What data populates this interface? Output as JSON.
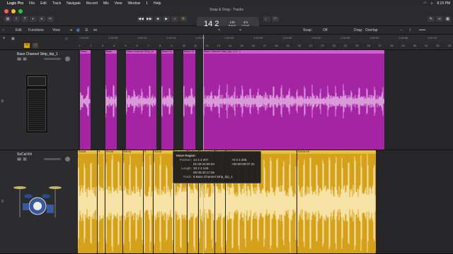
{
  "menubar": {
    "app": "Logic Pro",
    "items": [
      "File",
      "Edit",
      "Track",
      "Navigate",
      "Record",
      "Mix",
      "View",
      "Window",
      "1",
      "Help"
    ],
    "time": "8:15 PM"
  },
  "window": {
    "title": "Snap & Drag - Tracks"
  },
  "lcd": {
    "position": "14 2",
    "tempo": "145",
    "tempo_mode": "Keep",
    "signature": "4/4",
    "key": "Cmaj"
  },
  "toolbar": {
    "edit": "Edit",
    "functions": "Functions",
    "view": "View",
    "snap_label": "Snap:",
    "snap_value": "Off",
    "drag_label": "Drag:",
    "drag_value": "Overlap"
  },
  "ruler": {
    "times": [
      "1:00:00",
      "1:00:05",
      "1:00:10",
      "1:00:15",
      "1:00:20",
      "1:00:25",
      "1:00:30",
      "1:00:35",
      "1:00:40",
      "1:00:45",
      "1:00:50",
      "1:00:55",
      "1:01:00"
    ],
    "bars": [
      "1",
      "2",
      "3",
      "4",
      "5",
      "6",
      "7",
      "8",
      "9",
      "10",
      "11",
      "12",
      "13",
      "14",
      "15",
      "16",
      "17",
      "18",
      "19",
      "20",
      "21",
      "22",
      "23",
      "24",
      "25",
      "26",
      "27",
      "28",
      "29",
      "30",
      "31",
      "32",
      "33"
    ]
  },
  "tracks": [
    {
      "number": "8",
      "name": "Bass Channel Strip_bip_1",
      "m": "M",
      "s": "S",
      "color": "#b430b4"
    },
    {
      "number": "9",
      "name": "SoCal Kit",
      "m": "M",
      "s": "S",
      "color": "#d9a31f"
    }
  ],
  "bass_regions": [
    {
      "label": "Bass",
      "start": 0.4,
      "end": 2.4
    },
    {
      "label": "Bass",
      "start": 5.0,
      "end": 7.2
    },
    {
      "label": "Bass Channel Strip_bi",
      "start": 8.8,
      "end": 14.4
    },
    {
      "label": "Bass Ch",
      "start": 15.2,
      "end": 17.6
    },
    {
      "label": "Bass Ch",
      "start": 19.2,
      "end": 21.6
    },
    {
      "label": "Bass Channel Strip_bip_1.6 : 1",
      "start": 22.8,
      "end": 56.0
    }
  ],
  "kit_regions": [
    {
      "label": "SoCal",
      "start": 0.0,
      "end": 3.6
    },
    {
      "label": "S",
      "start": 3.6,
      "end": 5.0
    },
    {
      "label": "SoCal",
      "start": 5.0,
      "end": 8.2
    },
    {
      "label": "SoCal",
      "start": 8.2,
      "end": 12.0
    },
    {
      "label": "S",
      "start": 12.0,
      "end": 13.8
    },
    {
      "label": "SoCal",
      "start": 13.8,
      "end": 17.6
    },
    {
      "label": "S",
      "start": 17.6,
      "end": 20.0
    },
    {
      "label": "SoCal",
      "start": 20.0,
      "end": 22.0
    },
    {
      "label": "SoC",
      "start": 22.0,
      "end": 25.0
    },
    {
      "label": "S",
      "start": 25.0,
      "end": 27.0
    },
    {
      "label": "SoCal",
      "start": 27.0,
      "end": 40.0
    },
    {
      "label": "SoCal Kit",
      "start": 40.0,
      "end": 54.4
    }
  ],
  "tooltip": {
    "title": "Move Region:",
    "position_label": "Position:",
    "position_bars": "14 2 3 207.",
    "position_delta_bars": "+0 0 2 205.",
    "position_time": "01:00:22:05.54",
    "position_delta_time": "+00:00:00:07.31",
    "length_label": "Length:",
    "length_bars": "19 2 3 140.",
    "length_time": "00:00:32:17.06",
    "track_label": "Track:",
    "track_value": "8  Bass Channel Strip_bip_1"
  }
}
